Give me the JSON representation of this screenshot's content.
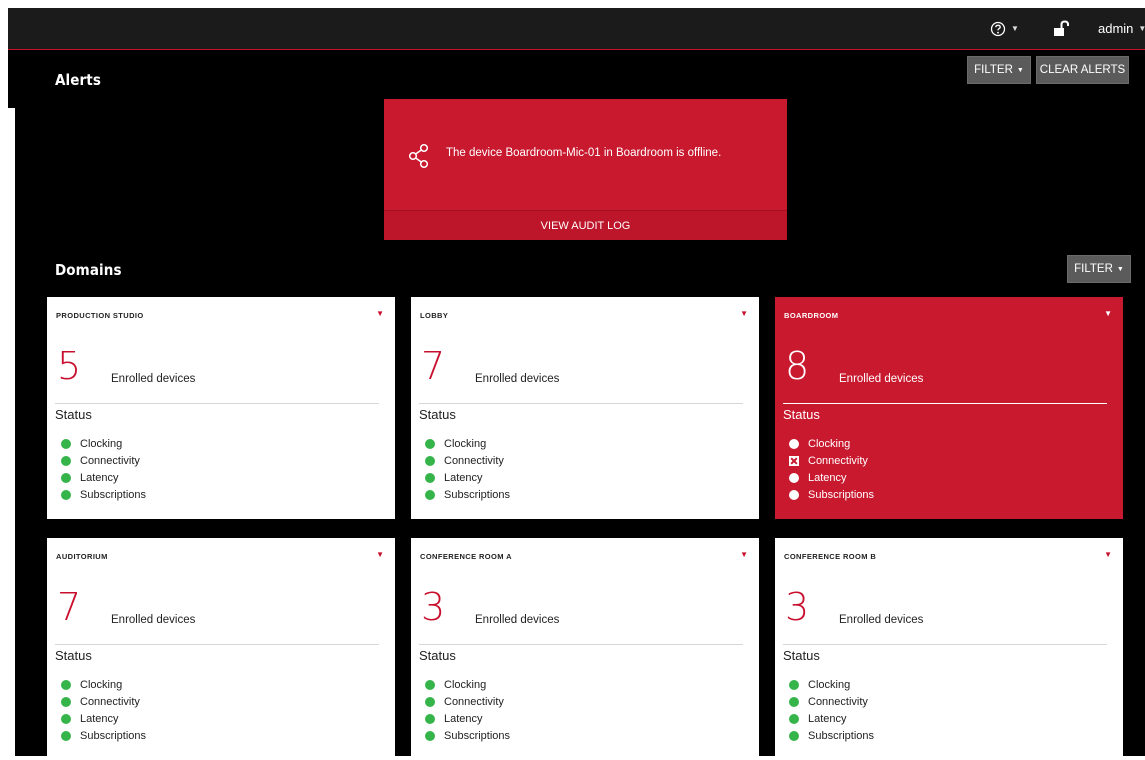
{
  "topbar": {
    "help_icon": "help-circle-icon",
    "lock_icon": "unlocked-padlock-icon",
    "user": "admin"
  },
  "alerts": {
    "title": "Alerts",
    "filter_label": "FILTER",
    "clear_label": "CLEAR ALERTS",
    "items": [
      {
        "icon": "share-network-icon",
        "message": "The device Boardroom-Mic-01 in Boardroom is offline.",
        "action": "VIEW AUDIT LOG"
      }
    ]
  },
  "domains": {
    "title": "Domains",
    "filter_label": "FILTER",
    "enrolled_label": "Enrolled devices",
    "status_label": "Status",
    "cards": [
      {
        "name": "PRODUCTION STUDIO",
        "count": "5",
        "alert": false,
        "checks": [
          {
            "label": "Clocking",
            "ok": true
          },
          {
            "label": "Connectivity",
            "ok": true
          },
          {
            "label": "Latency",
            "ok": true
          },
          {
            "label": "Subscriptions",
            "ok": true
          }
        ]
      },
      {
        "name": "LOBBY",
        "count": "7",
        "alert": false,
        "checks": [
          {
            "label": "Clocking",
            "ok": true
          },
          {
            "label": "Connectivity",
            "ok": true
          },
          {
            "label": "Latency",
            "ok": true
          },
          {
            "label": "Subscriptions",
            "ok": true
          }
        ]
      },
      {
        "name": "BOARDROOM",
        "count": "8",
        "alert": true,
        "checks": [
          {
            "label": "Clocking",
            "ok": true
          },
          {
            "label": "Connectivity",
            "ok": false
          },
          {
            "label": "Latency",
            "ok": true
          },
          {
            "label": "Subscriptions",
            "ok": true
          }
        ]
      },
      {
        "name": "AUDITORIUM",
        "count": "7",
        "alert": false,
        "checks": [
          {
            "label": "Clocking",
            "ok": true
          },
          {
            "label": "Connectivity",
            "ok": true
          },
          {
            "label": "Latency",
            "ok": true
          },
          {
            "label": "Subscriptions",
            "ok": true
          }
        ]
      },
      {
        "name": "CONFERENCE ROOM A",
        "count": "3",
        "alert": false,
        "checks": [
          {
            "label": "Clocking",
            "ok": true
          },
          {
            "label": "Connectivity",
            "ok": true
          },
          {
            "label": "Latency",
            "ok": true
          },
          {
            "label": "Subscriptions",
            "ok": true
          }
        ]
      },
      {
        "name": "CONFERENCE ROOM B",
        "count": "3",
        "alert": false,
        "checks": [
          {
            "label": "Clocking",
            "ok": true
          },
          {
            "label": "Connectivity",
            "ok": true
          },
          {
            "label": "Latency",
            "ok": true
          },
          {
            "label": "Subscriptions",
            "ok": true
          }
        ]
      }
    ]
  },
  "colors": {
    "accent": "#c8102e",
    "status_ok": "#35b44a",
    "background": "#000000",
    "topbar": "#1b1b1b"
  }
}
